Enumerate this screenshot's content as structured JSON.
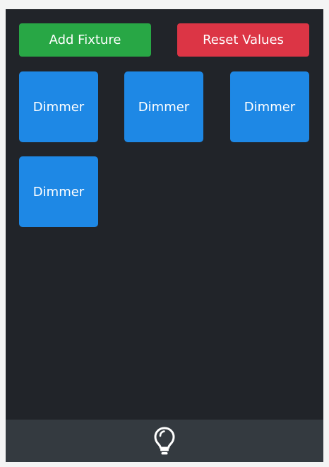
{
  "toolbar": {
    "add_fixture_label": "Add Fixture",
    "reset_values_label": "Reset Values"
  },
  "fixtures": [
    {
      "label": "Dimmer"
    },
    {
      "label": "Dimmer"
    },
    {
      "label": "Dimmer"
    },
    {
      "label": "Dimmer"
    }
  ],
  "bottom_bar": {
    "icon": "lightbulb-icon"
  },
  "colors": {
    "background": "#212429",
    "bottom_bar": "#343a40",
    "add_fixture": "#28a745",
    "reset_values": "#dc3545",
    "fixture": "#1e88e5"
  }
}
